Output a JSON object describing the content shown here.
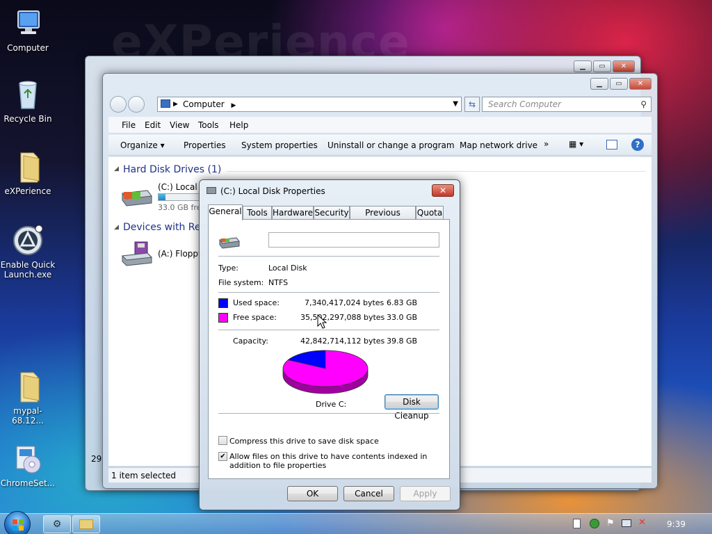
{
  "desktop": {
    "background_text": "eXPerience",
    "icons": [
      {
        "label": "Computer"
      },
      {
        "label": "Recycle Bin"
      },
      {
        "label": "eXPerience"
      },
      {
        "label": "Enable Quick Launch.exe"
      },
      {
        "label": "mypal-68.12..."
      },
      {
        "label": "ChromeSet..."
      }
    ]
  },
  "back_window": {
    "status_count": "29"
  },
  "explorer": {
    "address": "Computer",
    "search_placeholder": "Search Computer",
    "menu": [
      "File",
      "Edit",
      "View",
      "Tools",
      "Help"
    ],
    "commands": [
      "Organize ▾",
      "Properties",
      "System properties",
      "Uninstall or change a program",
      "Map network drive",
      "»"
    ],
    "groups": [
      {
        "title": "Hard Disk Drives (1)"
      },
      {
        "title": "Devices with Rem"
      }
    ],
    "drives": [
      {
        "name": "(C:) Local D",
        "free": "33.0 GB free",
        "used_fraction": 0.17
      },
      {
        "name": "(A:) Floppy"
      }
    ],
    "status": "1 item selected"
  },
  "dialog": {
    "title": "(C:) Local Disk Properties",
    "tabs": [
      "General",
      "Tools",
      "Hardware",
      "Security",
      "Previous Versions",
      "Quota"
    ],
    "active_tab": "General",
    "label_value": "",
    "type_label": "Type:",
    "type_value": "Local Disk",
    "fs_label": "File system:",
    "fs_value": "NTFS",
    "used_label": "Used space:",
    "used_bytes": "7,340,417,024 bytes",
    "used_gb": "6.83 GB",
    "free_label": "Free space:",
    "free_bytes": "35,502,297,088 bytes",
    "free_gb": "33.0 GB",
    "capacity_label": "Capacity:",
    "capacity_bytes": "42,842,714,112 bytes",
    "capacity_gb": "39.8 GB",
    "drive_label": "Drive C:",
    "cleanup_button": "Disk Cleanup",
    "compress_label": "Compress this drive to save disk space",
    "compress_checked": false,
    "index_label": "Allow files on this drive to have contents indexed in addition to file properties",
    "index_checked": true,
    "ok": "OK",
    "cancel": "Cancel",
    "apply": "Apply",
    "colors": {
      "used": "#0000ff",
      "free": "#ff00ff"
    },
    "used_fraction": 0.171
  },
  "taskbar": {
    "clock": "9:39"
  }
}
